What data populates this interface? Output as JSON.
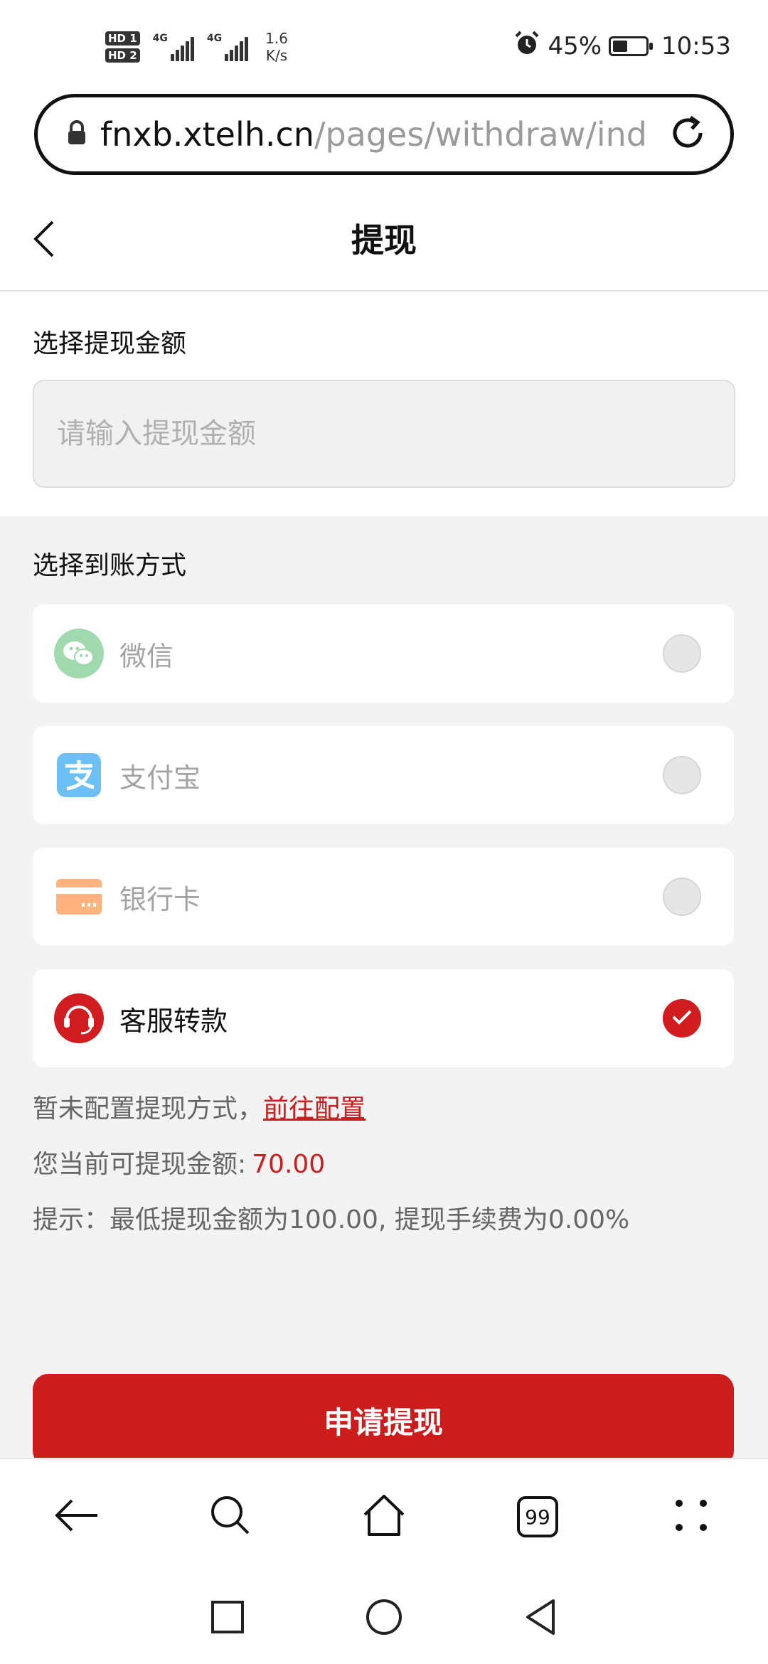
{
  "status_bar": {
    "hd1": "HD 1",
    "hd2": "HD 2",
    "net1": "4G",
    "net2": "4G",
    "speed_value": "1.6",
    "speed_unit": "K/s",
    "battery": "45%",
    "battery_level": 0.45,
    "time": "10:53",
    "icons": [
      "alarm-icon",
      "battery-charging-icon"
    ]
  },
  "browser": {
    "url_host": "fnxb.xtelh.cn",
    "url_path": "/pages/withdraw/ind",
    "icons": [
      "lock-icon",
      "reload-icon"
    ]
  },
  "header": {
    "title": "提现",
    "back_icon": "chevron-left-icon"
  },
  "amount": {
    "label": "选择提现金额",
    "placeholder": "请输入提现金额",
    "value": ""
  },
  "methods": {
    "label": "选择到账方式",
    "items": [
      {
        "label": "微信",
        "icon": "wechat-icon",
        "selected": false,
        "enabled": false,
        "color": "#07c160"
      },
      {
        "label": "支付宝",
        "icon": "alipay-icon",
        "selected": false,
        "enabled": false,
        "color": "#1677ff"
      },
      {
        "label": "银行卡",
        "icon": "bank-card-icon",
        "selected": false,
        "enabled": false,
        "color": "#ff8a3d"
      },
      {
        "label": "客服转款",
        "icon": "customer-service-icon",
        "selected": true,
        "enabled": true,
        "color": "#d11d1f"
      }
    ]
  },
  "notes": {
    "not_configured": "暂未配置提现方式，",
    "config_link": "前往配置",
    "available_label": "您当前可提现金额:",
    "available_value": "70.00",
    "hint": "提示：最低提现金额为100.00, 提现手续费为0.00%"
  },
  "submit_label": "申请提现",
  "browser_nav": {
    "icons": [
      "back-arrow-icon",
      "search-icon",
      "home-icon",
      "tabs-icon",
      "more-icon"
    ],
    "tabs_count": "99"
  },
  "system_nav": {
    "icons": [
      "recents-icon",
      "home-circle-icon",
      "back-triangle-icon"
    ]
  },
  "colors": {
    "accent": "#cc1c1c",
    "link": "#c81f20"
  }
}
